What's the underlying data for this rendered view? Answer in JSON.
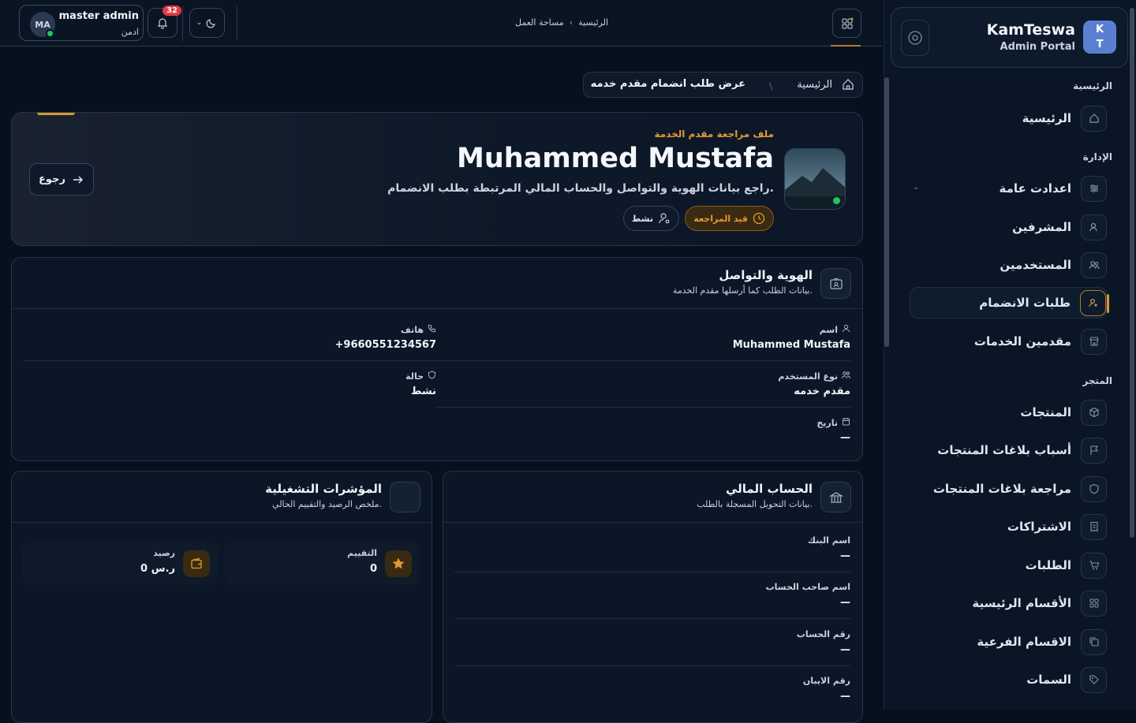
{
  "brand": {
    "logo_text": "K\nT",
    "title": "KamTeswa",
    "subtitle": "Admin Portal"
  },
  "sidebar": {
    "section_home": "الرئيسية",
    "section_admin": "الإدارة",
    "section_store": "المتجر",
    "items": [
      {
        "label": "الرئيسية",
        "icon": "home-icon"
      },
      {
        "label": "اعدادت عامة",
        "icon": "sliders-icon"
      },
      {
        "label": "المشرفين",
        "icon": "user-shield-icon"
      },
      {
        "label": "المستخدمين",
        "icon": "users-icon"
      },
      {
        "label": "طلبات الانضمام",
        "icon": "user-plus-icon"
      },
      {
        "label": "مقدمين الخدمات",
        "icon": "store-icon"
      },
      {
        "label": "المنتجات",
        "icon": "box-icon"
      },
      {
        "label": "أسباب بلاغات المنتجات",
        "icon": "flag-icon"
      },
      {
        "label": "مراجعة بلاغات المنتجات",
        "icon": "shield-icon"
      },
      {
        "label": "الاشتراكات",
        "icon": "receipt-icon"
      },
      {
        "label": "الطلبات",
        "icon": "cart-icon"
      },
      {
        "label": "الأقسام الرئيسية",
        "icon": "grid-icon"
      },
      {
        "label": "الاقسام الفرعية",
        "icon": "copy-icon"
      },
      {
        "label": "السمات",
        "icon": "tag-icon"
      }
    ]
  },
  "topbar": {
    "user_initials": "MA",
    "user_name": "master admin",
    "user_role": "ادمن",
    "notifications_count": "32",
    "crumb_home": "الرئيسية",
    "crumb_workspace": "مساحة العمل"
  },
  "breadcrumb": {
    "home": "الرئيسية",
    "current": "عرض طلب انضمام مقدم خدمه"
  },
  "hero": {
    "kicker": "ملف مراجعة مقدم الخدمة",
    "name": "Muhammed Mustafa",
    "description": "راجع بيانات الهوية والتواصل والحساب المالي المرتبطة بطلب الانضمام.",
    "status_review": "قيد المراجعة",
    "status_active": "نشط",
    "back_label": "رجوع"
  },
  "identity": {
    "title": "الهوية والتواصل",
    "subtitle": "بيانات الطلب كما أرسلها مقدم الخدمة.",
    "fields": [
      {
        "label": "اسم",
        "value": "Muhammed Mustafa"
      },
      {
        "label": "هاتف",
        "value": "+9660551234567"
      },
      {
        "label": "نوع المستخدم",
        "value": "مقدم خدمه"
      },
      {
        "label": "حالة",
        "value": "نشط"
      },
      {
        "label": "تاريخ",
        "value": "—"
      }
    ]
  },
  "finance": {
    "title": "الحساب المالي",
    "subtitle": "بيانات التحويل المسجلة بالطلب.",
    "fields": [
      {
        "label": "اسم البنك",
        "value": "—"
      },
      {
        "label": "اسم صاحب الحساب",
        "value": "—"
      },
      {
        "label": "رقم الحساب",
        "value": "—"
      },
      {
        "label": "رقم الايبان",
        "value": "—"
      }
    ]
  },
  "kpis": {
    "title": "المؤشرات التشغيلية",
    "subtitle": "ملخص الرصيد والتقييم الحالي.",
    "rating_label": "التقييم",
    "rating_value": "0",
    "balance_label": "رصيد",
    "balance_value": "0 ر.س"
  },
  "colors": {
    "accent": "#d99633",
    "online": "#22c55e",
    "badge": "#e23b46"
  }
}
